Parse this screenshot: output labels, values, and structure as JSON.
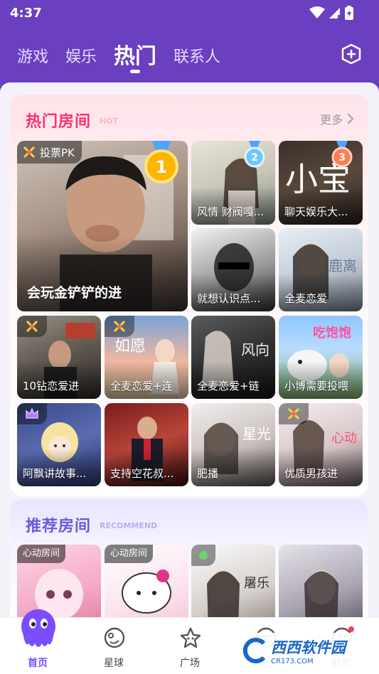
{
  "status_bar": {
    "time": "4:37"
  },
  "top_tabs": [
    {
      "label": "游戏",
      "active": false
    },
    {
      "label": "娱乐",
      "active": false
    },
    {
      "label": "热门",
      "active": true
    },
    {
      "label": "联系人",
      "active": false
    }
  ],
  "hot_section": {
    "title": "热门房间",
    "subtitle": "HOT",
    "more_label": "更多",
    "rooms": [
      {
        "name": "会玩金铲铲的进",
        "badge": "投票PK",
        "rank": "1"
      },
      {
        "name": "风情 财阀嘎...",
        "rank": "2"
      },
      {
        "name": "聊天娱乐大...",
        "rank": "3"
      },
      {
        "name": "就想认识点..."
      },
      {
        "name": "全麦恋爱"
      },
      {
        "name": "10钻恋爱进"
      },
      {
        "name": "全麦恋爱+连"
      },
      {
        "name": "全麦恋爱+链"
      },
      {
        "name": "小博需要投喂"
      },
      {
        "name": "阿飘讲故事..."
      },
      {
        "name": "支持空花叔..."
      },
      {
        "name": "肥播"
      },
      {
        "name": "优质男孩进"
      }
    ]
  },
  "recommend_section": {
    "title": "推荐房间",
    "subtitle": "RECOMMEND",
    "rooms": [
      {
        "tag": "心动房间"
      },
      {
        "tag": "心动房间"
      },
      {
        "tag": ""
      },
      {
        "tag": ""
      }
    ]
  },
  "bottom_nav": [
    {
      "label": "首页",
      "icon": "home-octopus-icon",
      "active": true
    },
    {
      "label": "星球",
      "icon": "planet-icon",
      "active": false
    },
    {
      "label": "广场",
      "icon": "star-icon",
      "active": false
    },
    {
      "label": "消息",
      "icon": "message-icon",
      "active": false
    },
    {
      "label": "我的",
      "icon": "profile-icon",
      "active": false
    }
  ],
  "watermark": {
    "main": "西西软件园",
    "sub": "CR173.COM"
  },
  "colors": {
    "brand": "#6a3fc0",
    "hot": "#ff2f6b",
    "recommend": "#6b5bd9",
    "nav_active": "#7c4dff"
  }
}
